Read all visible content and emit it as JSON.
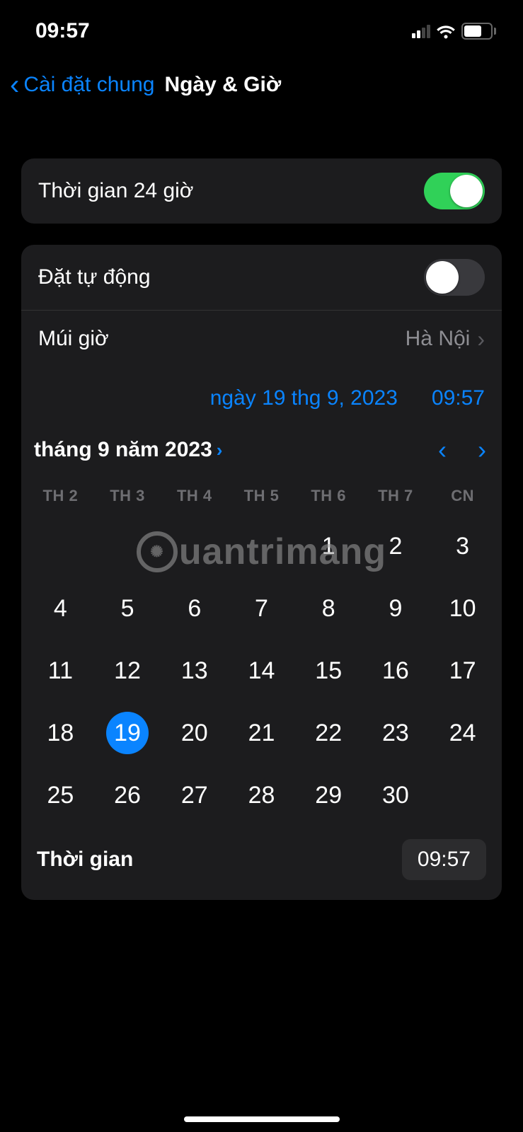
{
  "status": {
    "time": "09:57",
    "battery_percent": "66"
  },
  "nav": {
    "back_label": "Cài đặt chung",
    "title": "Ngày & Giờ"
  },
  "settings": {
    "time_24h_label": "Thời gian 24 giờ",
    "time_24h_on": true,
    "auto_set_label": "Đặt tự động",
    "auto_set_on": false,
    "timezone_label": "Múi giờ",
    "timezone_value": "Hà Nội"
  },
  "datetime": {
    "date_display": "ngày 19 thg 9, 2023",
    "time_display": "09:57"
  },
  "calendar": {
    "month_label": "tháng 9 năm 2023",
    "weekdays": [
      "TH 2",
      "TH 3",
      "TH 4",
      "TH 5",
      "TH 6",
      "TH 7",
      "CN"
    ],
    "leading_blanks": 4,
    "days_in_month": 30,
    "selected_day": 19
  },
  "time_picker": {
    "label": "Thời gian",
    "value": "09:57"
  },
  "watermark": "uantrimang"
}
